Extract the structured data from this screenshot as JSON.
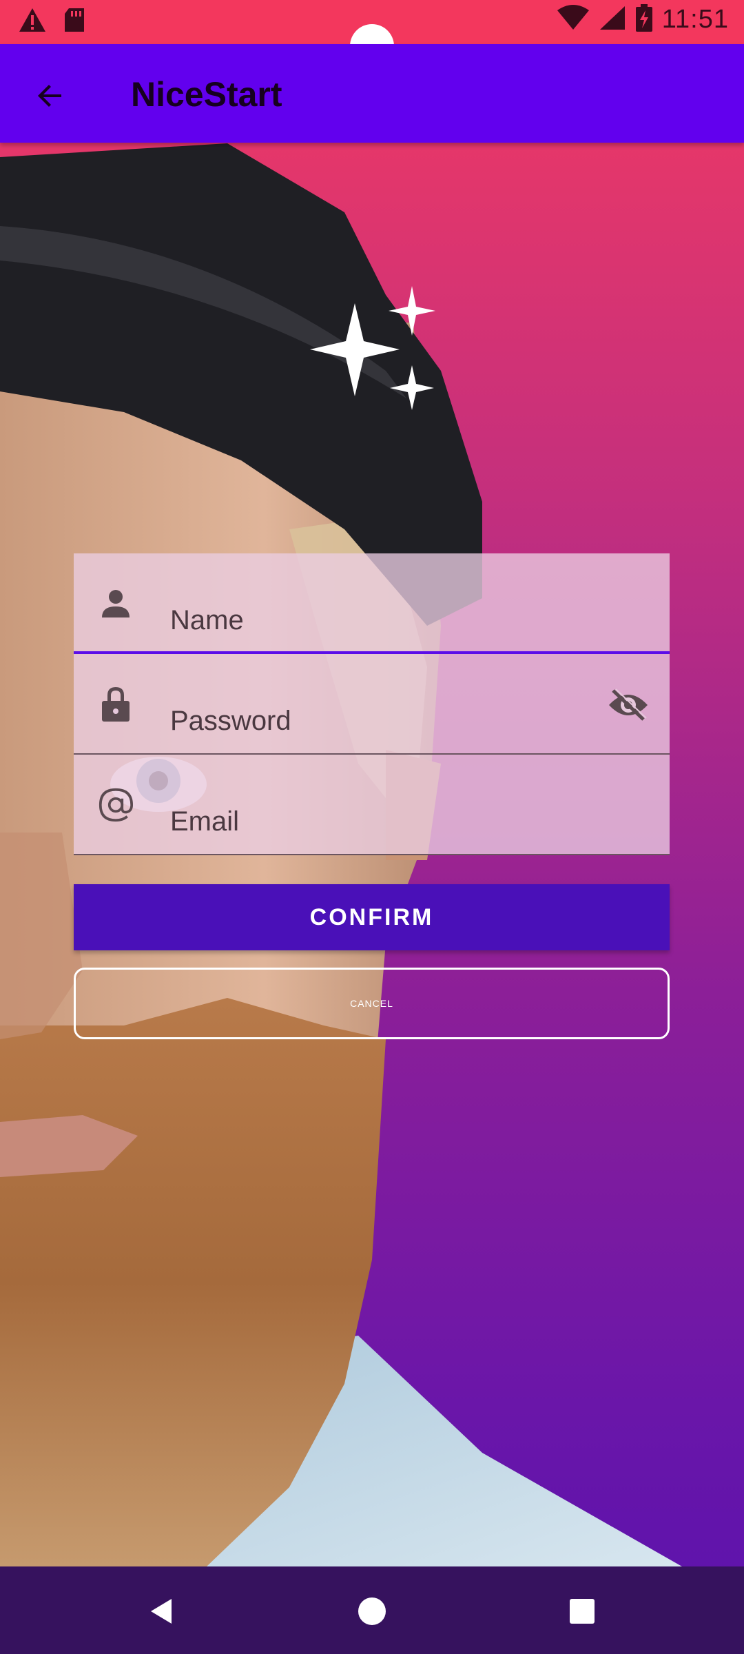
{
  "status_bar": {
    "time": "11:51",
    "icons": [
      "alert-icon",
      "sd-card-icon",
      "wifi-icon",
      "signal-icon",
      "battery-charging-icon"
    ]
  },
  "app_bar": {
    "title": "NiceStart",
    "back_icon": "arrow-back-icon"
  },
  "form": {
    "name_placeholder": "Name",
    "password_placeholder": "Password",
    "email_placeholder": "Email",
    "icons": {
      "name": "person-icon",
      "password": "lock-icon",
      "email": "at-sign-icon",
      "password_toggle": "eye-off-icon"
    }
  },
  "buttons": {
    "confirm_label": "CONFIRM",
    "cancel_label": "CANCEL"
  },
  "nav_bar": {
    "icons": [
      "back-triangle-icon",
      "home-circle-icon",
      "recents-square-icon"
    ]
  },
  "colors": {
    "app_bar": "#6200ee",
    "confirm_button": "#4a10b8",
    "nav_bar": "#36125e",
    "gradient_top": "#f23a62",
    "gradient_bottom": "#5a12ad"
  }
}
